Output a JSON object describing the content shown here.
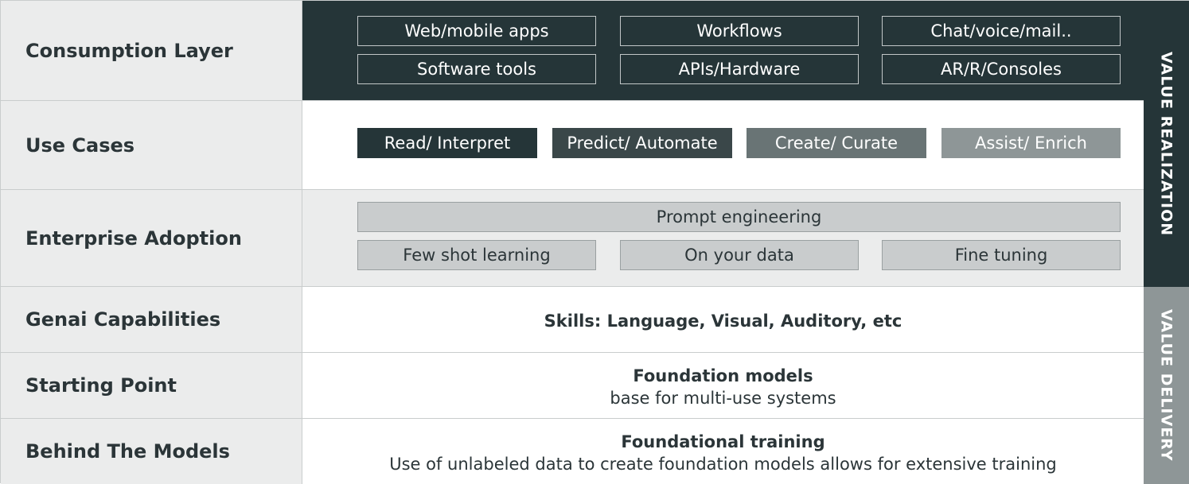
{
  "rows": {
    "consumption": {
      "label": "Consumption Layer",
      "items": [
        "Web/mobile apps",
        "Workflows",
        "Chat/voice/mail..",
        "Software tools",
        "APIs/Hardware",
        "AR/R/Consoles"
      ]
    },
    "use_cases": {
      "label": "Use Cases",
      "items": [
        "Read/ Interpret",
        "Predict/ Automate",
        "Create/ Curate",
        "Assist/ Enrich"
      ]
    },
    "adoption": {
      "label": "Enterprise Adoption",
      "top_item": "Prompt engineering",
      "items": [
        "Few shot learning",
        "On your data",
        "Fine tuning"
      ]
    },
    "capabilities": {
      "label": "Genai Capabilities",
      "text": "Skills: Language, Visual, Auditory, etc"
    },
    "starting_point": {
      "label": "Starting Point",
      "title": "Foundation models",
      "subtitle": "base for multi-use systems"
    },
    "behind_models": {
      "label": "Behind The Models",
      "title": "Foundational training",
      "subtitle": "Use of unlabeled data to create foundation models allows for extensive training"
    }
  },
  "side": {
    "top": "VALUE REALIZATION",
    "bottom": "VALUE DELIVERY"
  },
  "colors": {
    "dark": "#253538",
    "use_case_1": "#253538",
    "use_case_2": "#3a4749",
    "use_case_3": "#697475",
    "use_case_4": "#8e9697",
    "label_bg": "#ebecec",
    "side_bottom": "#8e9697"
  }
}
